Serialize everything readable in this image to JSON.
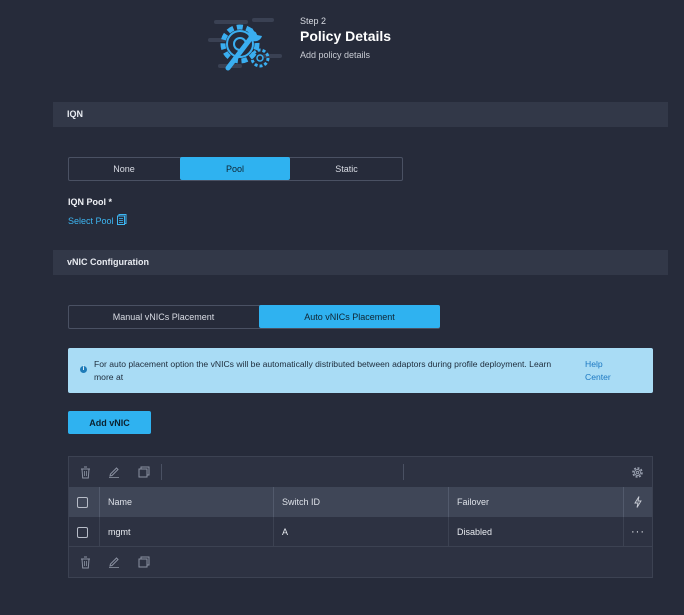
{
  "header": {
    "illustration_icon": "gear-wrench-icon",
    "step": "Step 2",
    "title": "Policy Details",
    "subtitle": "Add policy details"
  },
  "iqn": {
    "section_title": "IQN",
    "options": [
      "None",
      "Pool",
      "Static"
    ],
    "selected": "Pool",
    "pool_label": "IQN Pool *",
    "select_pool": "Select Pool",
    "select_pool_icon": "document-list-icon"
  },
  "vnic": {
    "section_title": "vNIC Configuration",
    "placement_options": [
      "Manual vNICs Placement",
      "Auto vNICs Placement"
    ],
    "selected": "Auto vNICs Placement",
    "info_icon": "info-icon",
    "info_text": "For auto placement option the vNICs will be automatically distributed between adaptors during profile deployment. Learn more at",
    "info_link": "Help Center",
    "add_button": "Add vNIC"
  },
  "table": {
    "toolbar_icons": [
      "trash-icon",
      "edit-pencil-icon",
      "copy-icon",
      "settings-gear-icon"
    ],
    "columns": [
      "Name",
      "Switch ID",
      "Failover"
    ],
    "header_action_icon": "lightning-icon",
    "rows": [
      {
        "name": "mgmt",
        "switch_id": "A",
        "failover": "Disabled"
      }
    ],
    "row_menu": "···"
  },
  "colors": {
    "accent": "#2fb2f0",
    "background": "#262b3a",
    "section_bar": "#323848",
    "info_bg": "#a9dcf5"
  }
}
